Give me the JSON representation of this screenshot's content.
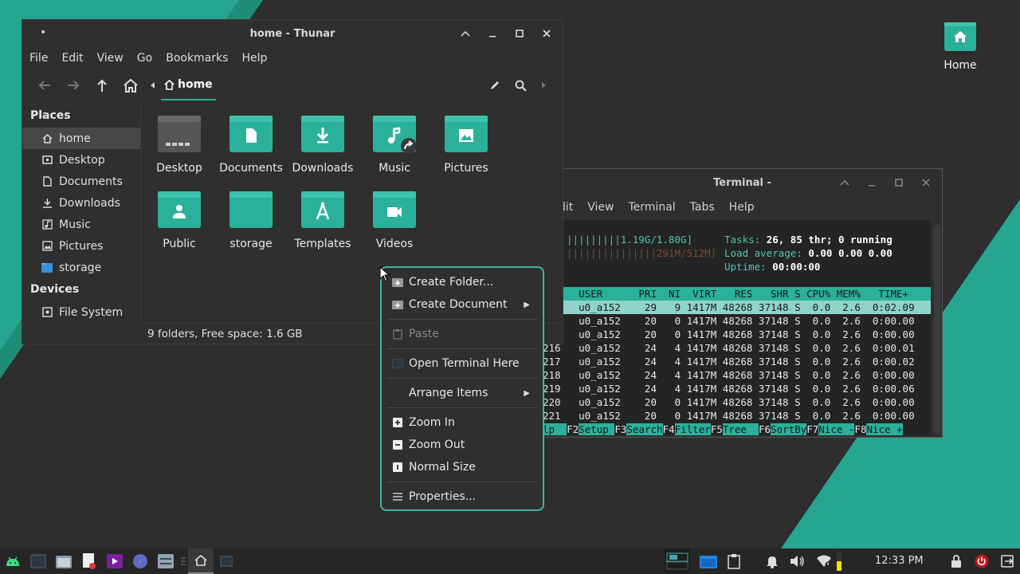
{
  "desktop": {
    "home_icon_label": "Home",
    "colors": {
      "accent": "#2bb19a",
      "background": "#2e2e2e"
    }
  },
  "thunar": {
    "title": "home - Thunar",
    "menu": [
      "File",
      "Edit",
      "View",
      "Go",
      "Bookmarks",
      "Help"
    ],
    "breadcrumb": "home",
    "places_header": "Places",
    "places": [
      {
        "label": "home",
        "icon": "home-icon"
      },
      {
        "label": "Desktop",
        "icon": "desktop-icon"
      },
      {
        "label": "Documents",
        "icon": "document-icon"
      },
      {
        "label": "Downloads",
        "icon": "download-icon"
      },
      {
        "label": "Music",
        "icon": "music-icon"
      },
      {
        "label": "Pictures",
        "icon": "picture-icon"
      },
      {
        "label": "storage",
        "icon": "folder-icon"
      }
    ],
    "devices_header": "Devices",
    "devices": [
      {
        "label": "File System",
        "icon": "drive-icon"
      }
    ],
    "files": [
      {
        "label": "Desktop",
        "icon": "desktop-folder-icon"
      },
      {
        "label": "Documents",
        "icon": "documents-folder-icon"
      },
      {
        "label": "Downloads",
        "icon": "downloads-folder-icon"
      },
      {
        "label": "Music",
        "icon": "music-folder-icon"
      },
      {
        "label": "Pictures",
        "icon": "pictures-folder-icon"
      },
      {
        "label": "Public",
        "icon": "public-folder-icon"
      },
      {
        "label": "storage",
        "icon": "folder-icon"
      },
      {
        "label": "Templates",
        "icon": "templates-folder-icon"
      },
      {
        "label": "Videos",
        "icon": "videos-folder-icon"
      }
    ],
    "status": "9 folders, Free space: 1.6 GB"
  },
  "terminal": {
    "title": "Terminal -",
    "menu": [
      "dit",
      "View",
      "Terminal",
      "Tabs",
      "Help"
    ],
    "mem_bar": "|||||||||1.19G/1.80G]",
    "swp_bar": "|||||||||||||||291M/512M]",
    "tasks_label": "Tasks: ",
    "tasks_value": "26, 85 thr; 0 running",
    "load_label": "Load average: ",
    "load_value": "0.00 0.00 0.00",
    "uptime_label": "Uptime: ",
    "uptime_value": "00:00:00",
    "header": "      USER      PRI  NI  VIRT   RES   SHR S CPU% MEM%   TIME+",
    "rows": [
      "      u0_a152    29   9 1417M 48268 37148 S  0.0  2.6  0:02.09",
      "      u0_a152    20   0 1417M 48268 37148 S  0.0  2.6  0:00.00",
      "      u0_a152    20   0 1417M 48268 37148 S  0.0  2.6  0:00.00",
      "216   u0_a152    24   4 1417M 48268 37148 S  0.0  2.6  0:00.01",
      "217   u0_a152    24   4 1417M 48268 37148 S  0.0  2.6  0:00.02",
      "218   u0_a152    24   4 1417M 48268 37148 S  0.0  2.6  0:00.00",
      "219   u0_a152    24   4 1417M 48268 37148 S  0.0  2.6  0:00.06",
      "220   u0_a152    20   0 1417M 48268 37148 S  0.0  2.6  0:00.00",
      "221   u0_a152    20   0 1417M 48268 37148 S  0.0  2.6  0:00.00"
    ],
    "fkeys": [
      {
        "key": "",
        "label": "lp  "
      },
      {
        "key": "F2",
        "label": "Setup "
      },
      {
        "key": "F3",
        "label": "Search"
      },
      {
        "key": "F4",
        "label": "Filter"
      },
      {
        "key": "F5",
        "label": "Tree  "
      },
      {
        "key": "F6",
        "label": "SortBy"
      },
      {
        "key": "F7",
        "label": "Nice -"
      },
      {
        "key": "F8",
        "label": "Nice +"
      }
    ]
  },
  "context_menu": {
    "items": [
      {
        "label": "Create Folder...",
        "icon": "add-folder-icon"
      },
      {
        "label": "Create Document",
        "icon": "add-document-icon",
        "submenu": true
      },
      {
        "label": "Paste",
        "icon": "paste-icon",
        "disabled": true
      },
      {
        "label": "Open Terminal Here",
        "icon": "terminal-icon"
      },
      {
        "label": "Arrange Items",
        "icon": "",
        "submenu": true
      },
      {
        "label": "Zoom In",
        "icon": "zoom-in-icon"
      },
      {
        "label": "Zoom Out",
        "icon": "zoom-out-icon"
      },
      {
        "label": "Normal Size",
        "icon": "normal-size-icon"
      },
      {
        "label": "Properties...",
        "icon": "properties-icon"
      }
    ]
  },
  "taskbar": {
    "clock": "12:33 PM"
  }
}
